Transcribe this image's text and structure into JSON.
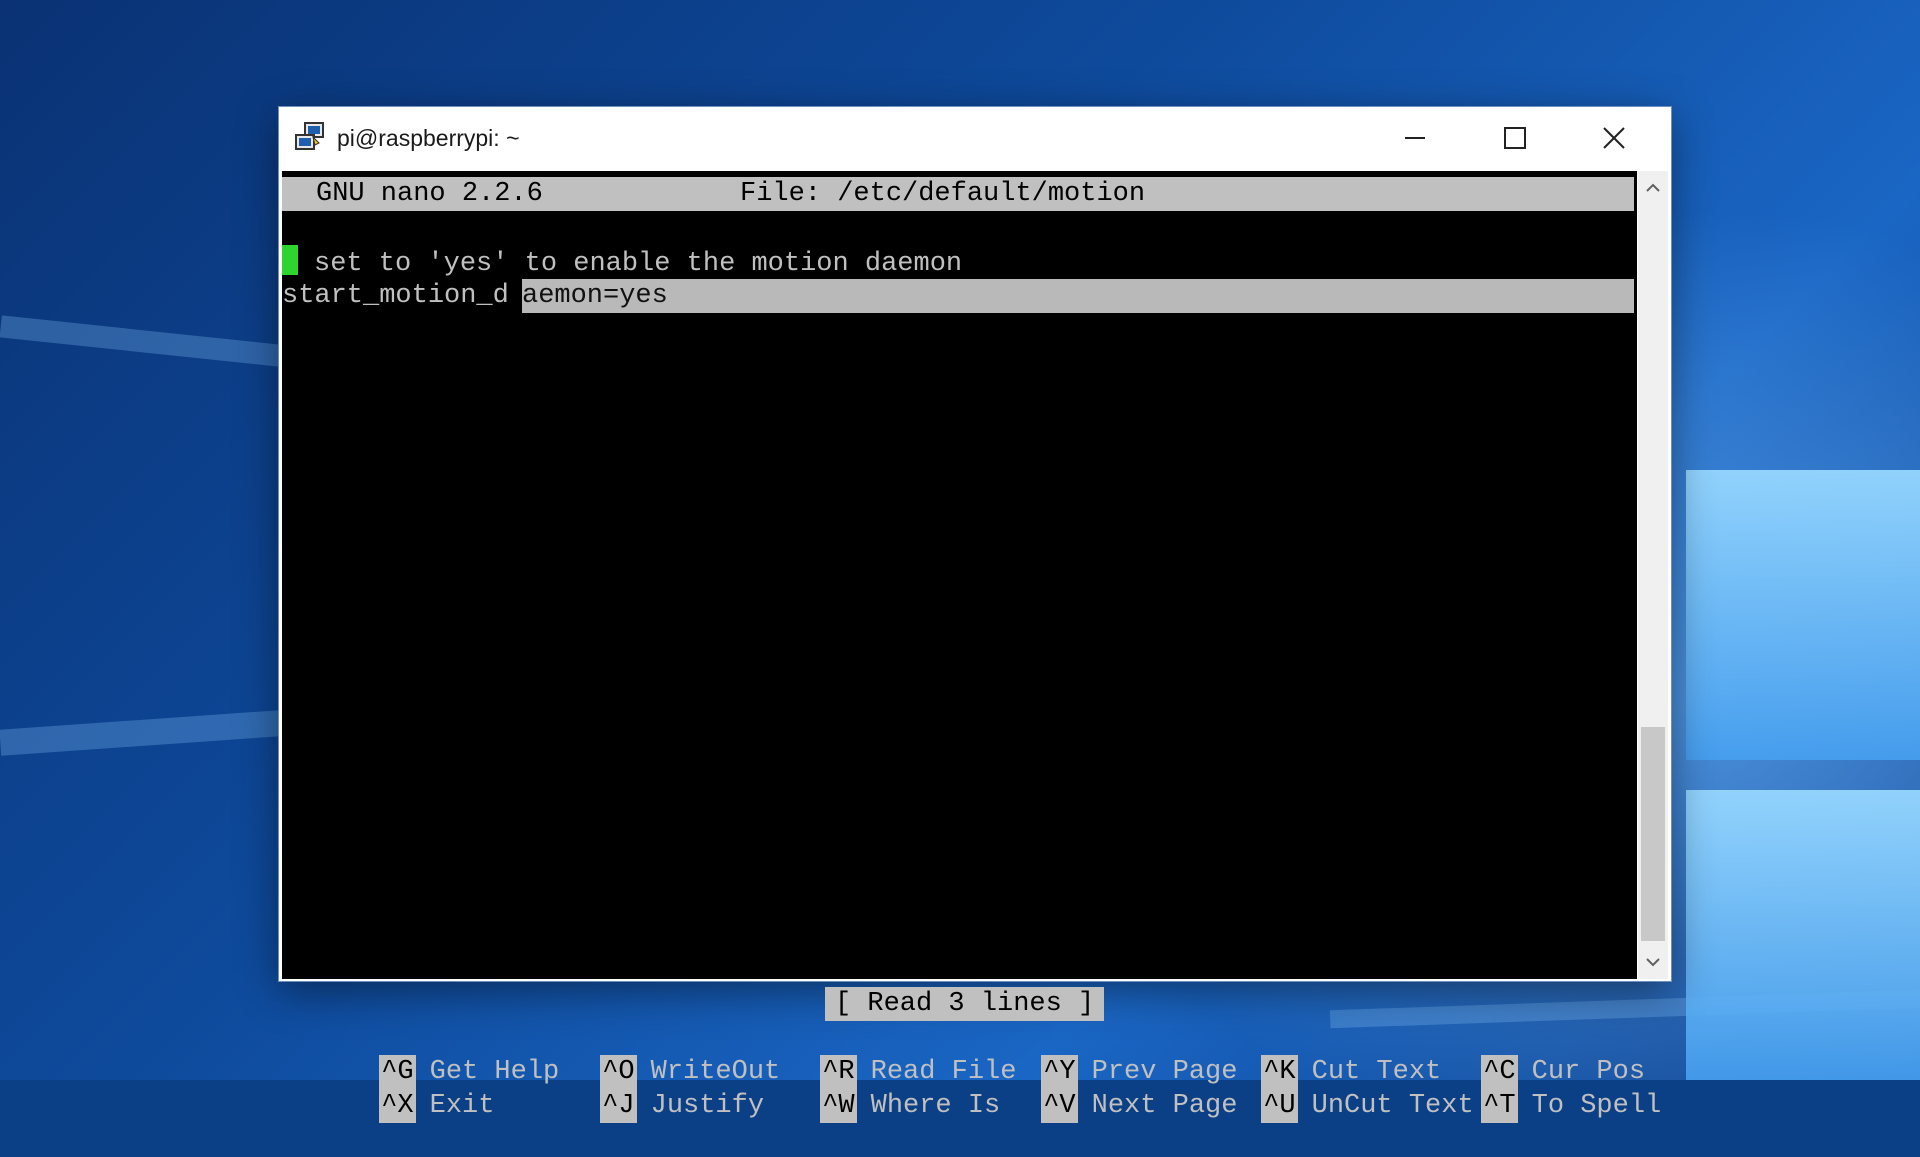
{
  "window": {
    "title": "pi@raspberrypi: ~"
  },
  "nano": {
    "version": "GNU nano 2.2.6",
    "file": "File: /etc/default/motion",
    "lines": {
      "comment": "set to 'yes' to enable the motion daemon",
      "setting_a": "start_motion_d",
      "setting_b": "aemon=yes"
    },
    "status": "[ Read 3 lines ]",
    "shortcuts": [
      {
        "key": "^G",
        "label": "Get Help"
      },
      {
        "key": "^O",
        "label": "WriteOut"
      },
      {
        "key": "^R",
        "label": "Read File"
      },
      {
        "key": "^Y",
        "label": "Prev Page"
      },
      {
        "key": "^K",
        "label": "Cut Text"
      },
      {
        "key": "^C",
        "label": "Cur Pos"
      },
      {
        "key": "^X",
        "label": "Exit"
      },
      {
        "key": "^J",
        "label": "Justify"
      },
      {
        "key": "^W",
        "label": "Where Is"
      },
      {
        "key": "^V",
        "label": "Next Page"
      },
      {
        "key": "^U",
        "label": "UnCut Text"
      },
      {
        "key": "^T",
        "label": "To Spell"
      }
    ]
  },
  "icons": {
    "app": "putty-icon",
    "minimize": "minimize-icon",
    "maximize": "maximize-icon",
    "close": "close-icon"
  },
  "colors": {
    "cursor": "#2fd52f",
    "terminal_bg": "#000000",
    "terminal_fg": "#c0c0c0",
    "inverse_bg": "#c0c0c0"
  }
}
